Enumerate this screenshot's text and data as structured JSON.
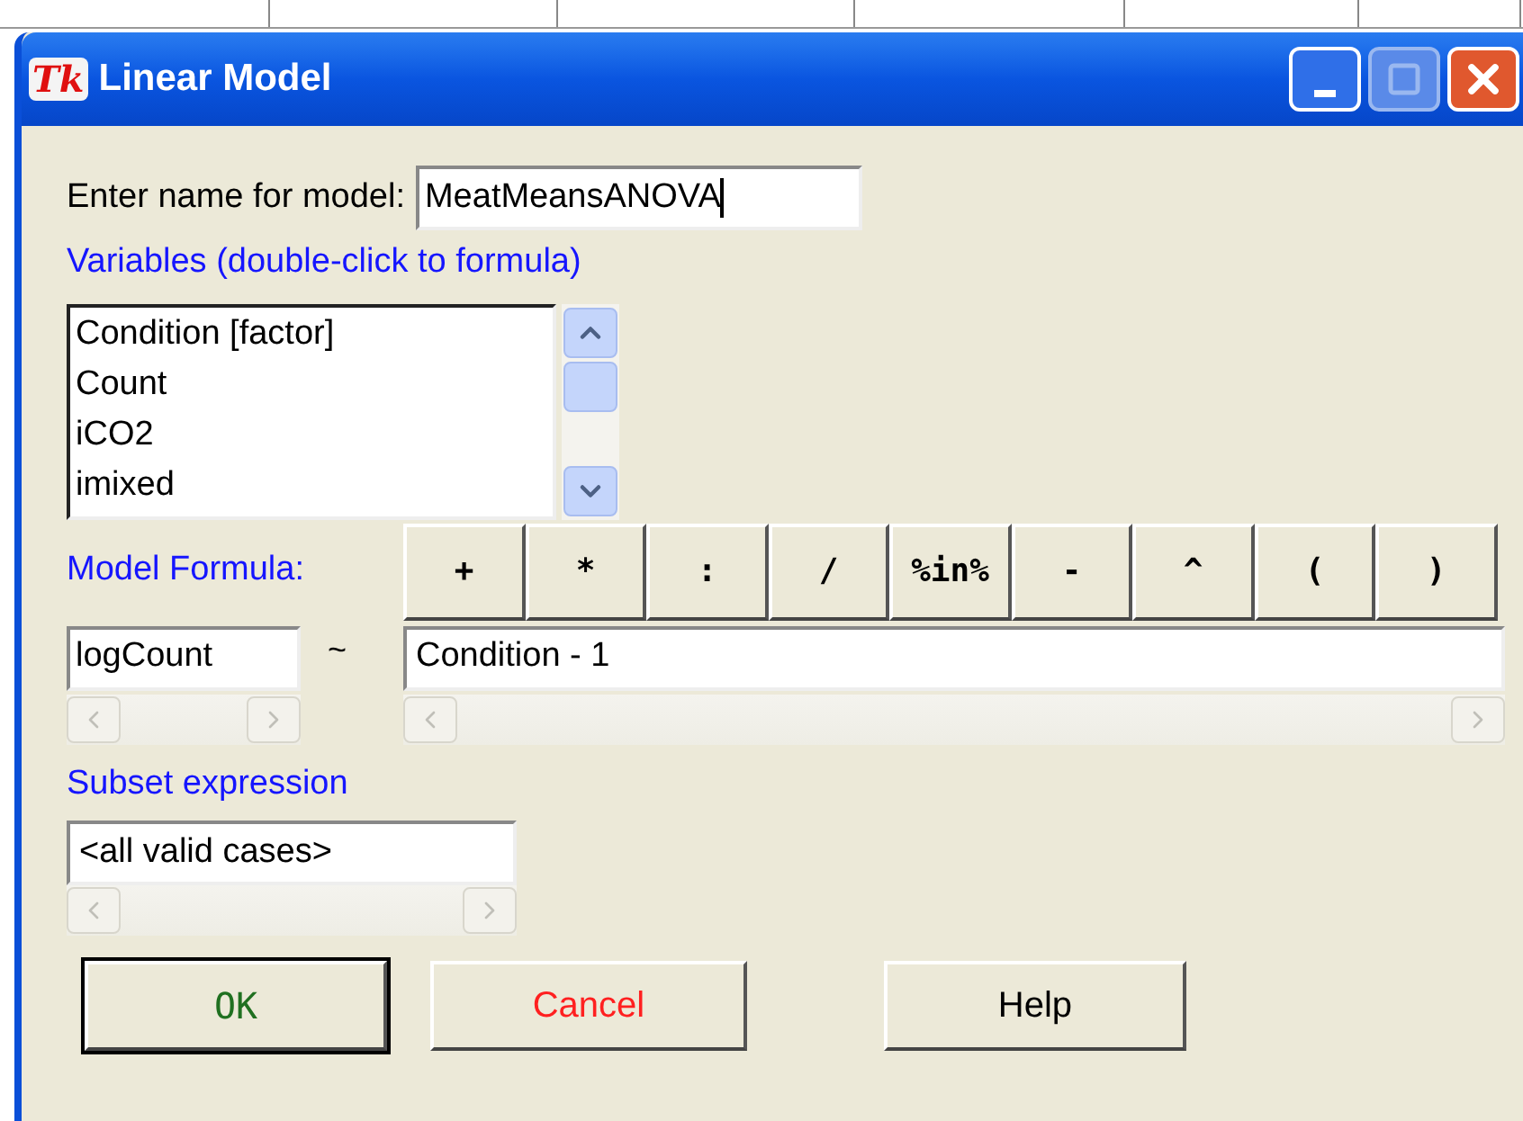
{
  "window": {
    "logo": "Tk",
    "title": "Linear Model"
  },
  "name_field": {
    "label": "Enter name for model:",
    "value": "MeatMeansANOVA"
  },
  "variables": {
    "label": "Variables (double-click to formula)",
    "items": [
      {
        "text": "Condition [factor]",
        "selected": false
      },
      {
        "text": "Count",
        "selected": false
      },
      {
        "text": "iCO2",
        "selected": false
      },
      {
        "text": "imixed",
        "selected": false
      }
    ]
  },
  "model_formula": {
    "label": "Model Formula:",
    "operators": [
      "+",
      "*",
      ":",
      "/",
      "%in%",
      "-",
      "^",
      "(",
      ")"
    ],
    "response": "logCount",
    "tilde": "~",
    "formula": "Condition - 1"
  },
  "subset": {
    "label": "Subset expression",
    "value": "<all valid cases>"
  },
  "buttons": [
    {
      "label": "OK",
      "kind": "ok",
      "default": true
    },
    {
      "label": "Cancel",
      "kind": "cancel",
      "default": false
    },
    {
      "label": "Help",
      "kind": "help",
      "default": false
    }
  ]
}
